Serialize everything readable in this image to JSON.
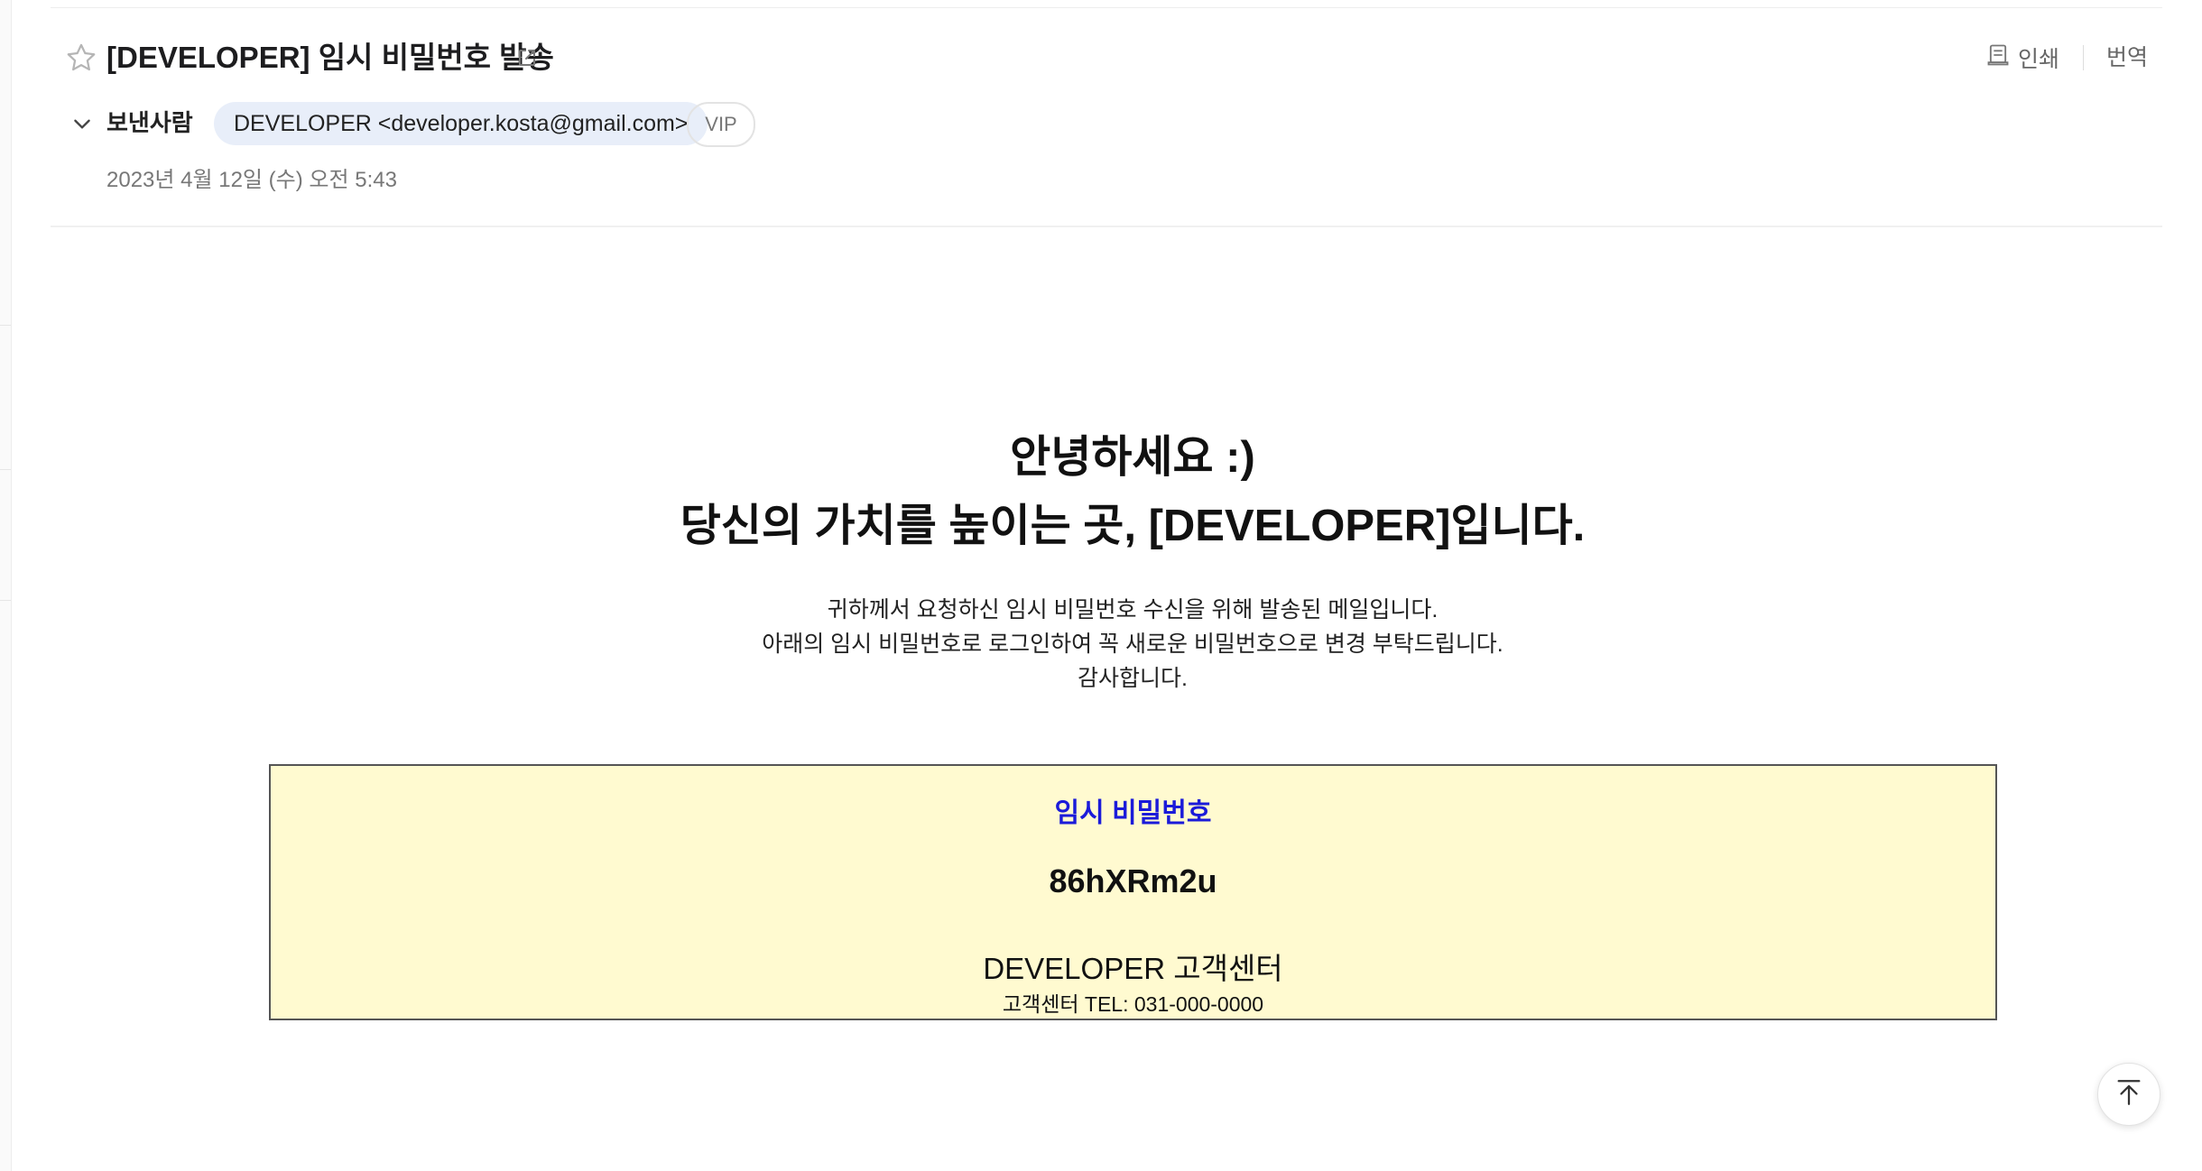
{
  "mail": {
    "subject": "[DEVELOPER] 임시 비밀번호 발송",
    "sender_label": "보낸사람",
    "sender": "DEVELOPER <developer.kosta@gmail.com>",
    "vip_badge": "VIP",
    "date": "2023년 4월 12일 (수) 오전 5:43"
  },
  "actions": {
    "print": "인쇄",
    "translate": "번역"
  },
  "body": {
    "greeting_line1": "안녕하세요 :)",
    "greeting_line2": "당신의 가치를 높이는 곳, [DEVELOPER]입니다.",
    "text_line1": "귀하께서 요청하신 임시 비밀번호 수신을 위해 발송된 메일입니다.",
    "text_line2": "아래의 임시 비밀번호로 로그인하여 꼭 새로운 비밀번호으로 변경 부탁드립니다.",
    "text_line3": "감사합니다.",
    "password_box": {
      "label": "임시 비밀번호",
      "password": "86hXRm2u",
      "support_title": "DEVELOPER 고객센터",
      "support_tel": "고객센터 TEL: 031-000-0000"
    }
  },
  "icons": {
    "star": "star-icon",
    "popout": "external-link-icon",
    "printer": "printer-icon",
    "chevron": "chevron-down-icon",
    "scroll_top": "arrow-up-to-top-icon"
  },
  "colors": {
    "password_label": "#1b1bd9",
    "password_box_bg": "#fffad0",
    "sender_chip_bg": "#e8eef9"
  }
}
